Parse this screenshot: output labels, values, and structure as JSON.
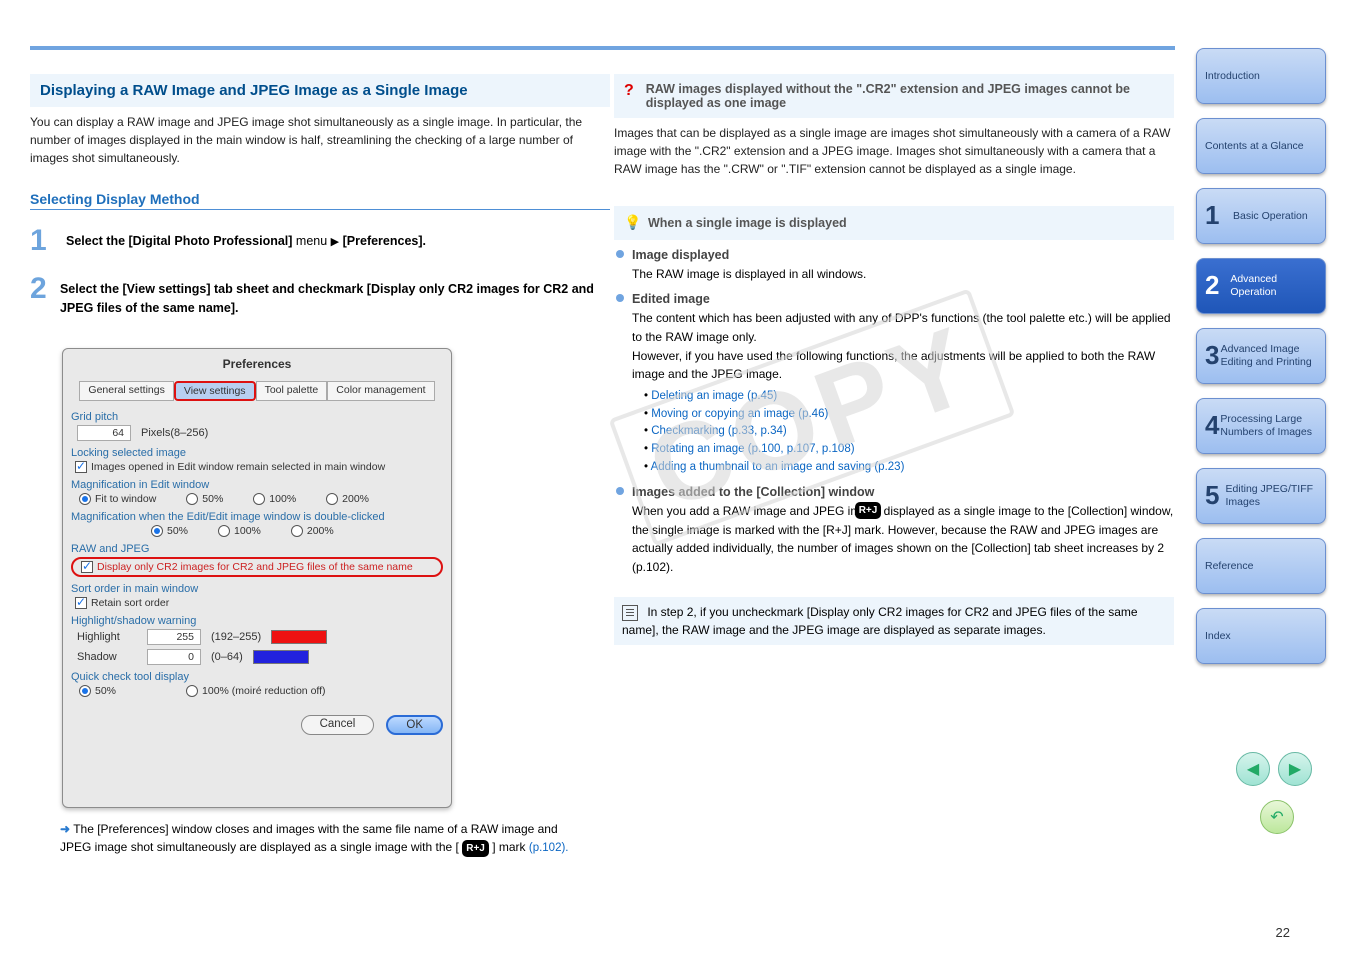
{
  "left": {
    "banner": "Displaying a RAW Image and JPEG Image as a Single Image",
    "intro": "You can display a RAW image and JPEG image shot simultaneously as a single image. In particular, the number of images displayed in the main window is half, streamlining the checking of a large number of images shot simultaneously.",
    "sub_title": "Selecting Display Method",
    "step1": {
      "menu1": "Select the [Digital Photo Professional]",
      "arrow": "▶",
      "menu2": "menu ",
      "bold": "[Preferences]."
    },
    "step2": "Select the [View settings] tab sheet and checkmark [Display only CR2 images for CR2 and JPEG files of the same name].",
    "arrow_note_pre": "The [Preferences] window closes and images with the same file name of a RAW image and JPEG image shot simultaneously are displayed as a single image with the [",
    "arrow_note_post": "] mark ",
    "arrow_note_page": "(p.102)."
  },
  "dialog": {
    "title": "Preferences",
    "tabs": [
      "General settings",
      "View settings",
      "Tool palette",
      "Color management"
    ],
    "grid_label": "Grid pitch",
    "grid_value": "64",
    "grid_unit": "Pixels(8–256)",
    "lock_label": "Locking selected image",
    "lock_chk": "Images opened in Edit window remain selected in main window",
    "mag_label": "Magnification in Edit window",
    "mag_opts": [
      "Fit to window",
      "50%",
      "100%",
      "200%"
    ],
    "mag2_label": "Magnification when the Edit/Edit image window is double-clicked",
    "mag2_opts": [
      "50%",
      "100%",
      "200%"
    ],
    "raw_label": "RAW and JPEG",
    "raw_chk": "Display only CR2 images for CR2 and JPEG files of the same name",
    "sort_label": "Sort order in main window",
    "sort_chk": "Retain sort order",
    "hls_label": "Highlight/shadow warning",
    "hl": "Highlight",
    "hl_val": "255",
    "hl_range": "(192–255)",
    "sh": "Shadow",
    "sh_val": "0",
    "sh_range": "(0–64)",
    "quick_label": "Quick check tool display",
    "quick_opts": [
      "50%",
      "100% (moiré reduction off)"
    ],
    "btn_cancel": "Cancel",
    "btn_ok": "OK"
  },
  "right": {
    "q_title": "RAW images displayed without the \".CR2\" extension and JPEG images cannot be displayed as one image",
    "q_body": "Images that can be displayed as a single image are images shot simultaneously with a camera of a RAW image with the \".CR2\" extension and a JPEG image. Images shot simultaneously with a camera that a RAW image has the \".CRW\" or \".TIF\" extension cannot be displayed as a single image.",
    "tip_title": "When a single image is displayed",
    "tips": [
      {
        "h": "Image displayed",
        "t": "The RAW image is displayed in all windows."
      },
      {
        "h": "Edited image",
        "t": "The content which has been adjusted with any of DPP's functions (the tool palette etc.) will be applied to the RAW image only.\nHowever, if you have used the following functions, the adjustments will be applied to both the RAW image and the JPEG image.",
        "sub": [
          "Deleting an image (p.45)",
          "Moving or copying an image (p.46)",
          "Checkmarking (p.33, p.34)",
          "Rotating an image (p.100, p.107, p.108)",
          "Adding a thumbnail to an image and saving (p.23)"
        ]
      },
      {
        "h": "Images added to the [Collection] window",
        "t": "When you add a RAW image and JPEG image displayed as a single image to the [Collection] window, the single image is marked with the [R+J] mark. However, because the RAW and JPEG images are actually added individually, the number of images shown on the [Collection] tab sheet increases by 2 (p.102)."
      }
    ],
    "note": "In step 2, if you uncheckmark [Display only CR2 images for CR2 and JPEG files of the same name], the RAW image and the JPEG image are displayed as separate images."
  },
  "nav": [
    {
      "num": "",
      "label": "Introduction"
    },
    {
      "num": "",
      "label": "Contents at a Glance"
    },
    {
      "num": "1",
      "label": "Basic Operation"
    },
    {
      "num": "2",
      "label": "Advanced Operation"
    },
    {
      "num": "3",
      "label": "Advanced Image Editing and Printing"
    },
    {
      "num": "4",
      "label": "Processing Large Numbers of Images"
    },
    {
      "num": "5",
      "label": "Editing JPEG/TIFF Images"
    },
    {
      "num": "",
      "label": "Reference"
    },
    {
      "num": "",
      "label": "Index"
    }
  ],
  "rj_badge": "R+J",
  "watermark": "COPY",
  "page": "22"
}
